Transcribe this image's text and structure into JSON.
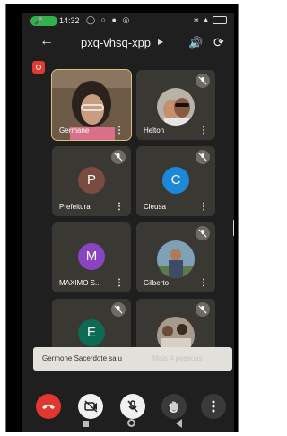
{
  "status": {
    "time": "14:32"
  },
  "call": {
    "meeting_code": "pxq-vhsq-xpp"
  },
  "participants": [
    {
      "name": "Germane",
      "initial": "",
      "color": "",
      "muted": false,
      "photo": true
    },
    {
      "name": "Helton",
      "initial": "",
      "color": "",
      "muted": true,
      "photo": true
    },
    {
      "name": "Prefeitura",
      "initial": "P",
      "color": "#7a4b3f",
      "muted": true,
      "photo": false
    },
    {
      "name": "Cleusa",
      "initial": "C",
      "color": "#1e88d8",
      "muted": true,
      "photo": false
    },
    {
      "name": "MAXIMO S...",
      "initial": "M",
      "color": "#8a44c2",
      "muted": true,
      "photo": false
    },
    {
      "name": "Gilberto",
      "initial": "",
      "color": "",
      "muted": true,
      "photo": true
    },
    {
      "name": "",
      "initial": "E",
      "color": "#0e6b53",
      "muted": true,
      "photo": false
    },
    {
      "name": "",
      "initial": "",
      "color": "",
      "muted": true,
      "photo": true
    }
  ],
  "toast": {
    "message": "Germone Sacerdote saiu",
    "action": "Mais 4 pessoas"
  },
  "colors": {
    "hangup": "#e3362f",
    "background": "#1f1f1f",
    "tile": "#3a3833",
    "active_outline": "#d8c27a"
  },
  "icons": [
    "mic-icon",
    "back-arrow-icon",
    "chevron-right-icon",
    "speaker-icon",
    "camera-switch-icon",
    "record-icon",
    "mic-off-icon",
    "more-vert-icon",
    "hangup-icon",
    "camera-off-icon",
    "hand-icon",
    "home-icon",
    "back-triangle-icon",
    "recent-apps-icon"
  ]
}
